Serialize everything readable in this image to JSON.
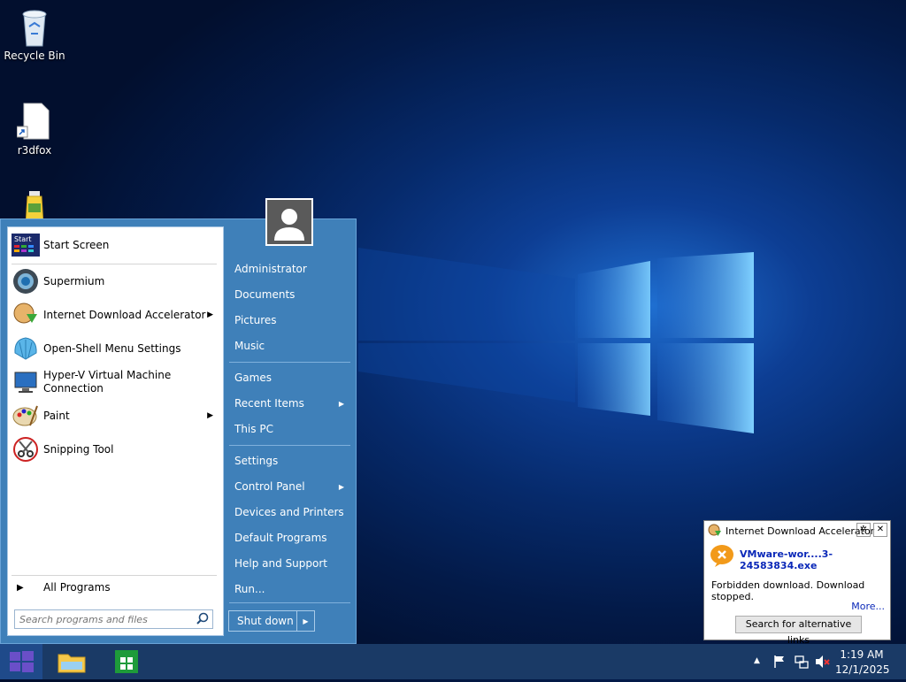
{
  "desktop": {
    "icons": [
      {
        "label": "Recycle Bin",
        "icon": "recycle-bin-icon"
      },
      {
        "label": "r3dfox",
        "icon": "shortcut-file-icon"
      },
      {
        "label": "",
        "icon": "bottle-icon"
      }
    ]
  },
  "start_menu": {
    "programs": [
      {
        "label": "Start Screen",
        "icon": "start-screen-icon",
        "submenu": false
      },
      {
        "label": "Supermium",
        "icon": "supermium-icon",
        "submenu": false
      },
      {
        "label": "Internet Download Accelerator",
        "icon": "ida-icon",
        "submenu": true
      },
      {
        "label": "Open-Shell Menu Settings",
        "icon": "shell-icon",
        "submenu": false
      },
      {
        "label": "Hyper-V Virtual Machine Connection",
        "icon": "monitor-icon",
        "submenu": false
      },
      {
        "label": "Paint",
        "icon": "paint-icon",
        "submenu": true
      },
      {
        "label": "Snipping Tool",
        "icon": "scissors-icon",
        "submenu": false
      }
    ],
    "all_programs": "All Programs",
    "search_placeholder": "Search programs and files",
    "right_items": [
      {
        "label": "Administrator",
        "submenu": false
      },
      {
        "label": "Documents",
        "submenu": false
      },
      {
        "label": "Pictures",
        "submenu": false
      },
      {
        "label": "Music",
        "submenu": false
      },
      {
        "label": "Games",
        "submenu": false
      },
      {
        "label": "Recent Items",
        "submenu": true
      },
      {
        "label": "This PC",
        "submenu": false
      },
      {
        "label": "Settings",
        "submenu": false
      },
      {
        "label": "Control Panel",
        "submenu": true
      },
      {
        "label": "Devices and Printers",
        "submenu": false
      },
      {
        "label": "Default Programs",
        "submenu": false
      },
      {
        "label": "Help and Support",
        "submenu": false
      },
      {
        "label": "Run...",
        "submenu": false
      }
    ],
    "shutdown": "Shut down"
  },
  "notification": {
    "title": "Internet Download Accelerator",
    "file": "VMware-wor....3-24583834.exe",
    "message": "Forbidden download. Download stopped.",
    "more": "More...",
    "button": "Search for alternative links"
  },
  "taskbar": {
    "pinned": [
      "file-explorer-icon",
      "store-icon"
    ],
    "time": "1:19 AM",
    "date": "12/1/2025"
  },
  "colors": {
    "menu_blue": "#3f80b9",
    "taskbar": "#1a3a66",
    "link_blue": "#0a28b8"
  }
}
